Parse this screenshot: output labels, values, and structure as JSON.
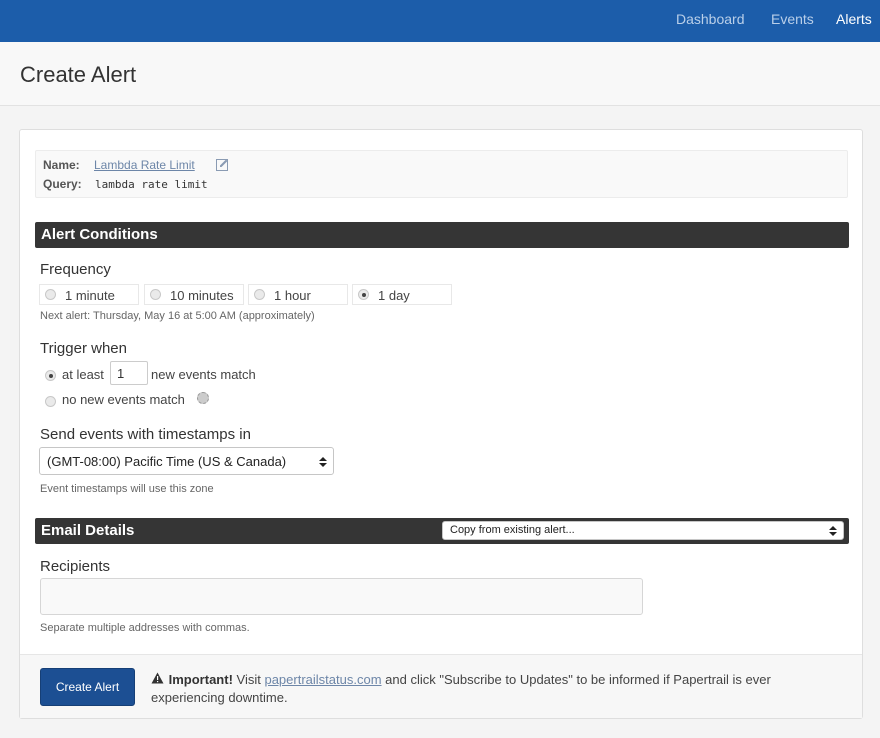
{
  "nav": {
    "items": [
      {
        "label": "Dashboard",
        "active": false
      },
      {
        "label": "Events",
        "active": false
      },
      {
        "label": "Alerts",
        "active": true
      }
    ]
  },
  "page": {
    "title": "Create Alert"
  },
  "search": {
    "name_label": "Name:",
    "name_value": "Lambda Rate Limit",
    "query_label": "Query:",
    "query_value": "lambda rate limit"
  },
  "conditions": {
    "section_title": "Alert Conditions",
    "frequency_label": "Frequency",
    "frequency_options": [
      {
        "label": "1 minute",
        "selected": false
      },
      {
        "label": "10 minutes",
        "selected": false
      },
      {
        "label": "1 hour",
        "selected": false
      },
      {
        "label": "1 day",
        "selected": true
      }
    ],
    "next_alert": "Next alert: Thursday, May 16 at 5:00 AM (approximately)",
    "trigger_label": "Trigger when",
    "trigger_at_least": "at least",
    "trigger_count": "1",
    "trigger_new_events": "new events match",
    "trigger_no_new": "no new events match",
    "timezone_label": "Send events with timestamps in",
    "timezone_value": "(GMT-08:00) Pacific Time (US & Canada)",
    "timezone_hint": "Event timestamps will use this zone"
  },
  "email": {
    "section_title": "Email Details",
    "copy_select": "Copy from existing alert...",
    "recipients_label": "Recipients",
    "recipients_value": "",
    "recipients_hint": "Separate multiple addresses with commas."
  },
  "footer": {
    "create_button": "Create Alert",
    "important": "Important!",
    "visit": " Visit ",
    "status_link": "papertrailstatus.com",
    "notice_rest": " and click \"Subscribe to Updates\" to be informed if Papertrail is ever experiencing downtime."
  },
  "colors": {
    "nav_bg": "#1c5daa",
    "section_bar": "#353535",
    "button": "#1c4f93",
    "link": "#6d86a8"
  }
}
